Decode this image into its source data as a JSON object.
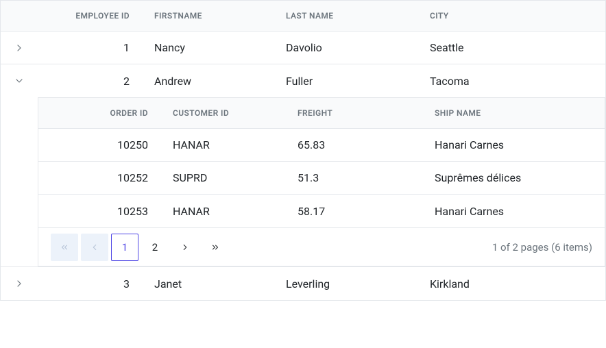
{
  "grid": {
    "headers": {
      "employee_id": "Employee ID",
      "first_name": "Firstname",
      "last_name": "Last Name",
      "city": "City"
    },
    "rows": [
      {
        "expanded": false,
        "id": "1",
        "first_name": "Nancy",
        "last_name": "Davolio",
        "city": "Seattle"
      },
      {
        "expanded": true,
        "id": "2",
        "first_name": "Andrew",
        "last_name": "Fuller",
        "city": "Tacoma"
      },
      {
        "expanded": false,
        "id": "3",
        "first_name": "Janet",
        "last_name": "Leverling",
        "city": "Kirkland"
      }
    ]
  },
  "detail": {
    "headers": {
      "order_id": "Order ID",
      "customer_id": "Customer ID",
      "freight": "Freight",
      "ship_name": "Ship Name"
    },
    "rows": [
      {
        "order_id": "10250",
        "customer_id": "HANAR",
        "freight": "65.83",
        "ship_name": "Hanari Carnes"
      },
      {
        "order_id": "10252",
        "customer_id": "SUPRD",
        "freight": "51.3",
        "ship_name": "Suprêmes délices"
      },
      {
        "order_id": "10253",
        "customer_id": "HANAR",
        "freight": "58.17",
        "ship_name": "Hanari Carnes"
      }
    ],
    "pager": {
      "pages": [
        "1",
        "2"
      ],
      "current": "1",
      "info": "1 of 2 pages (6 items)"
    }
  }
}
